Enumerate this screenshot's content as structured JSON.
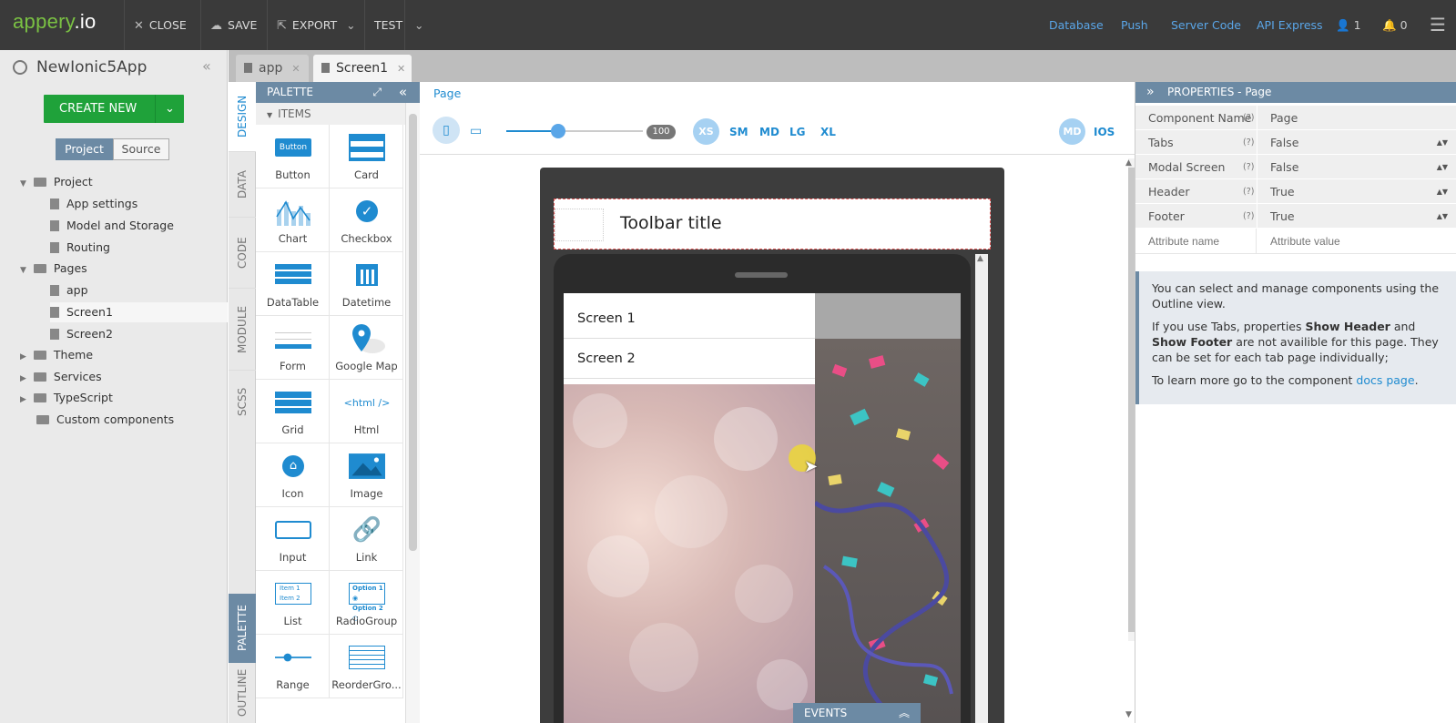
{
  "topbar": {
    "logo_main": "appery",
    "logo_suffix": ".io",
    "close": "CLOSE",
    "save": "SAVE",
    "export": "EXPORT",
    "test": "TEST",
    "links": [
      "Database",
      "Push",
      "Server Code",
      "API Express"
    ],
    "user_count": "1",
    "notif_count": "0"
  },
  "project": {
    "name": "NewIonic5App",
    "create_new": "CREATE NEW",
    "tab_project": "Project",
    "tab_source": "Source",
    "tree": {
      "project": "Project",
      "app_settings": "App settings",
      "model_storage": "Model and Storage",
      "routing": "Routing",
      "pages": "Pages",
      "app": "app",
      "screen1": "Screen1",
      "screen2": "Screen2",
      "theme": "Theme",
      "services": "Services",
      "typescript": "TypeScript",
      "custom": "Custom components"
    }
  },
  "editor_tabs": [
    "app",
    "Screen1"
  ],
  "vtabs": [
    "DESIGN",
    "DATA",
    "CODE",
    "MODULE",
    "SCSS",
    "PALETTE",
    "OUTLINE"
  ],
  "palette": {
    "title": "PALETTE",
    "section": "ITEMS",
    "items": [
      "Button",
      "Card",
      "Chart",
      "Checkbox",
      "DataTable",
      "Datetime",
      "Form",
      "Google Map",
      "Grid",
      "Html",
      "Icon",
      "Image",
      "Input",
      "Link",
      "List",
      "RadioGroup",
      "Range",
      "ReorderGro..."
    ],
    "button_icon_text": "Button",
    "html_icon_text": "<html />",
    "list_icon_text": [
      "Item 1",
      "Item 2"
    ],
    "radio_icon_text": [
      "Option 1",
      "Option 2"
    ]
  },
  "canvas": {
    "breadcrumb": "Page",
    "zoom": "100",
    "sizes": [
      "XS",
      "SM",
      "MD",
      "LG",
      "XL"
    ],
    "mode_badge": "MD",
    "platform": "IOS",
    "toolbar_title": "Toolbar title",
    "menu_items": [
      "Screen 1",
      "Screen 2"
    ],
    "events": "EVENTS"
  },
  "properties": {
    "title": "PROPERTIES - Page",
    "rows": [
      {
        "key": "Component Name",
        "help": "(?)",
        "value": "Page"
      },
      {
        "key": "Tabs",
        "help": "(?)",
        "value": "False"
      },
      {
        "key": "Modal Screen",
        "help": "(?)",
        "value": "False"
      },
      {
        "key": "Header",
        "help": "(?)",
        "value": "True"
      },
      {
        "key": "Footer",
        "help": "(?)",
        "value": "True"
      }
    ],
    "attr_name_placeholder": "Attribute name",
    "attr_value_placeholder": "Attribute value",
    "info1": "You can select and manage components using the Outline view.",
    "info2_pre": "If you use Tabs, properties ",
    "info2_b1": "Show Header",
    "info2_mid": " and ",
    "info2_b2": "Show Footer",
    "info2_post": " are not availible for this page. They can be set for each tab page individually;",
    "info3_pre": "To learn more go to the component ",
    "info3_link": "docs page",
    "info3_post": "."
  },
  "colors": {
    "accent": "#1f8bd0",
    "green": "#1fa23a",
    "header_blue": "#6c8aa4",
    "topbar": "#3a3a3a"
  }
}
